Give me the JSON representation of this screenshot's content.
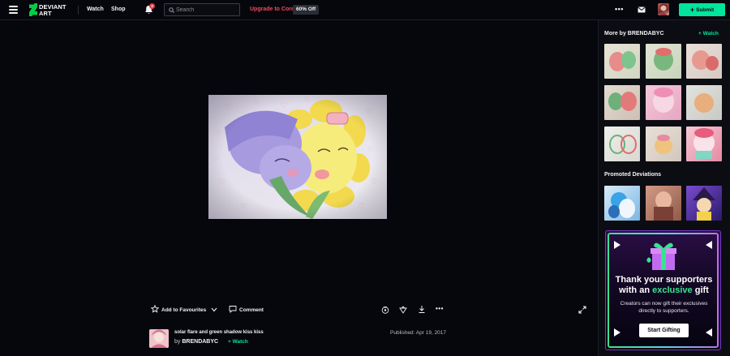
{
  "topbar": {
    "logo_line1": "DEVIANT",
    "logo_line2": "ART",
    "nav": {
      "watch": "Watch",
      "shop": "Shop"
    },
    "notification_count": "3",
    "search_placeholder": "Search",
    "upgrade_label": "Upgrade to Core",
    "promo_badge": "60% Off",
    "submit_label": "Submit"
  },
  "deviation": {
    "actions": {
      "favourite": "Add to Favourites",
      "comment": "Comment"
    },
    "title": "solar flare and green shadow kiss kiss",
    "by_prefix": "by",
    "author": "BRENDABYC",
    "watch_label": "+ Watch",
    "published": "Published: Apr 19, 2017"
  },
  "sidebar": {
    "more_by_heading": "More by BRENDABYC",
    "watch_label": "+ Watch",
    "promoted_heading": "Promoted Deviations",
    "ad": {
      "heading_line1": "Thank your supporters",
      "heading_line2_pre": "with an",
      "heading_line2_accent": "exclusive",
      "heading_line2_post": "gift",
      "body": "Creators can now gift their exclusives directly to supporters.",
      "button": "Start Gifting"
    }
  },
  "colors": {
    "background": "#06070d",
    "accent_green": "#00e59b",
    "upgrade_red": "#f2495b"
  }
}
